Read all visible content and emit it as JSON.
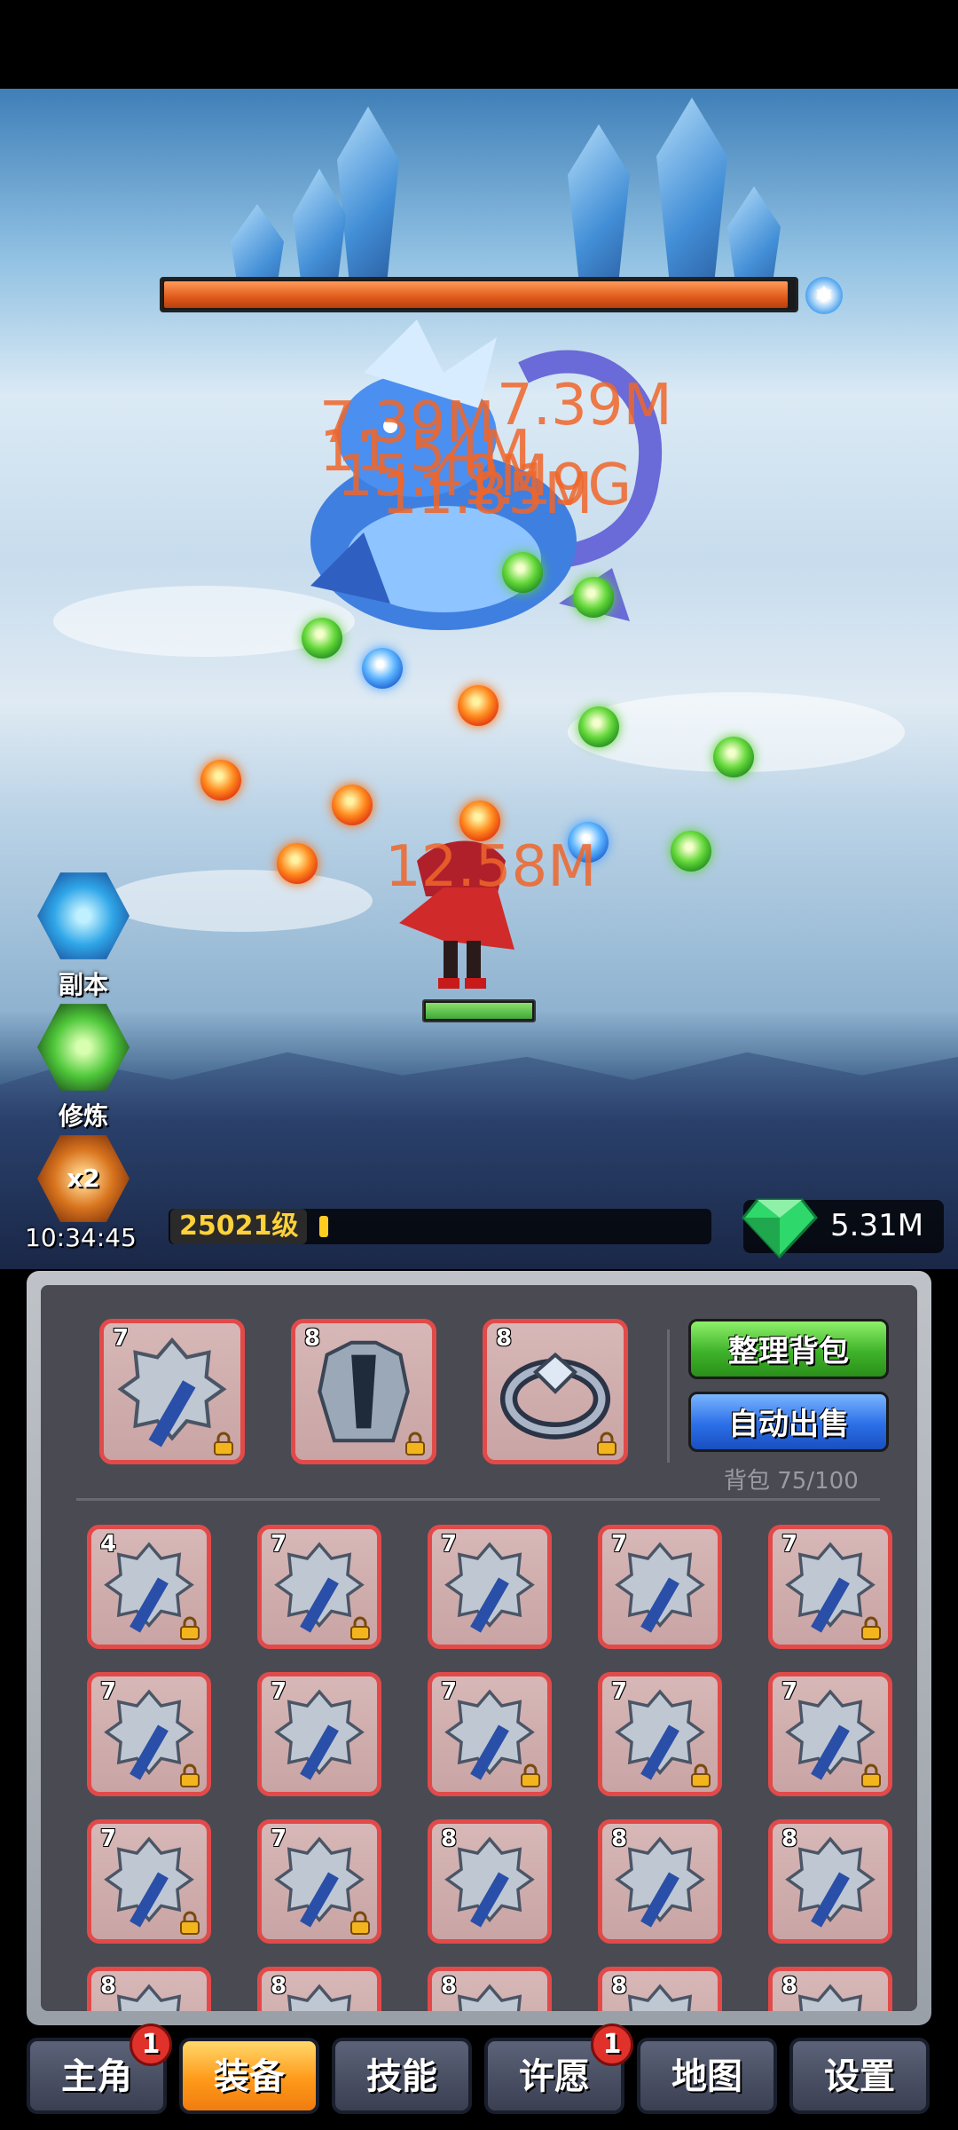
{
  "battle": {
    "boss_hp_fraction": 0.99,
    "damage_numbers": [
      "7.39M",
      "7.39M",
      "11.54M",
      "15.49M",
      "11.85M",
      "1.19G",
      "12.58M"
    ],
    "hero_hp_fraction": 1.0
  },
  "side": {
    "dungeon_label": "副本",
    "cultivate_label": "修炼",
    "boost_multiplier": "x2",
    "boost_timer": "10:34:45"
  },
  "status": {
    "level_label": "25021级",
    "level_progress_fraction": 0.02,
    "gems": "5.31M"
  },
  "bag": {
    "equipped": [
      {
        "level": "7",
        "item": "mace-icon",
        "locked": true
      },
      {
        "level": "8",
        "item": "armor-icon",
        "locked": true
      },
      {
        "level": "8",
        "item": "ring-icon",
        "locked": true
      }
    ],
    "sort_label": "整理背包",
    "auto_sell_label": "自动出售",
    "capacity_label": "背包 75/100",
    "items": [
      {
        "level": "4",
        "locked": true
      },
      {
        "level": "7",
        "locked": true
      },
      {
        "level": "7",
        "locked": false
      },
      {
        "level": "7",
        "locked": false
      },
      {
        "level": "7",
        "locked": true
      },
      {
        "level": "7",
        "locked": true
      },
      {
        "level": "7",
        "locked": false
      },
      {
        "level": "7",
        "locked": true
      },
      {
        "level": "7",
        "locked": true
      },
      {
        "level": "7",
        "locked": true
      },
      {
        "level": "7",
        "locked": true
      },
      {
        "level": "7",
        "locked": true
      },
      {
        "level": "8",
        "locked": false
      },
      {
        "level": "8",
        "locked": false
      },
      {
        "level": "8",
        "locked": false
      },
      {
        "level": "8",
        "locked": false
      },
      {
        "level": "8",
        "locked": false
      },
      {
        "level": "8",
        "locked": false
      },
      {
        "level": "8",
        "locked": false
      },
      {
        "level": "8",
        "locked": false
      }
    ]
  },
  "nav": {
    "tabs": [
      {
        "label": "主角",
        "badge": "1",
        "active": false
      },
      {
        "label": "装备",
        "badge": "",
        "active": true
      },
      {
        "label": "技能",
        "badge": "",
        "active": false
      },
      {
        "label": "许愿",
        "badge": "1",
        "active": false
      },
      {
        "label": "地图",
        "badge": "",
        "active": false
      },
      {
        "label": "设置",
        "badge": "",
        "active": false
      }
    ]
  }
}
